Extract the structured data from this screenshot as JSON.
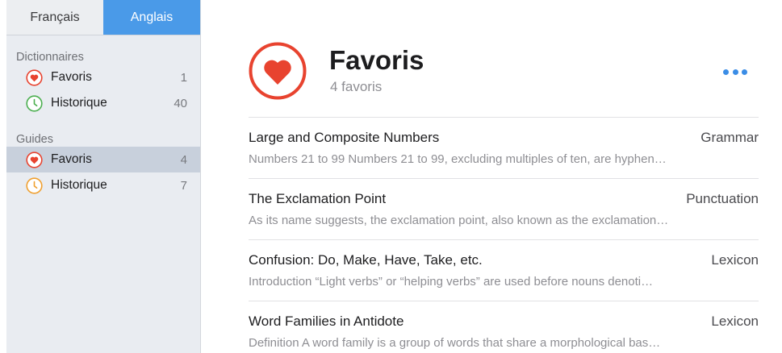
{
  "language_switch": {
    "french": "Français",
    "english": "Anglais",
    "active": "english"
  },
  "sidebar": {
    "sections": [
      {
        "title": "Dictionnaires",
        "items": [
          {
            "label": "Favoris",
            "count": "1",
            "icon": "heart-icon",
            "selected": false
          },
          {
            "label": "Historique",
            "count": "40",
            "icon": "clock-icon",
            "selected": false
          }
        ]
      },
      {
        "title": "Guides",
        "items": [
          {
            "label": "Favoris",
            "count": "4",
            "icon": "heart-icon",
            "selected": true
          },
          {
            "label": "Historique",
            "count": "7",
            "icon": "clock-icon",
            "selected": false
          }
        ]
      }
    ]
  },
  "header": {
    "title": "Favoris",
    "subtitle": "4 favoris",
    "more_icon": "ellipsis-icon"
  },
  "list": [
    {
      "title": "Large and Composite Numbers",
      "category": "Grammar",
      "description": "Numbers 21 to 99 Numbers 21 to 99, excluding multiples of ten, are hyphen…"
    },
    {
      "title": "The Exclamation Point",
      "category": "Punctuation",
      "description": "As its name suggests, the exclamation point, also known as the exclamation…"
    },
    {
      "title": "Confusion: Do, Make, Have, Take, etc.",
      "category": "Lexicon",
      "description": "Introduction “Light verbs” or “helping verbs” are used before nouns denoti…"
    },
    {
      "title": "Word Families in Antidote",
      "category": "Lexicon",
      "description": "Definition A word family is a group of words that share a morphological bas…"
    }
  ],
  "colors": {
    "accent": "#4a9ae8",
    "heart": "#e8432f",
    "clock_green": "#4caf50",
    "clock_orange": "#f0a030"
  }
}
